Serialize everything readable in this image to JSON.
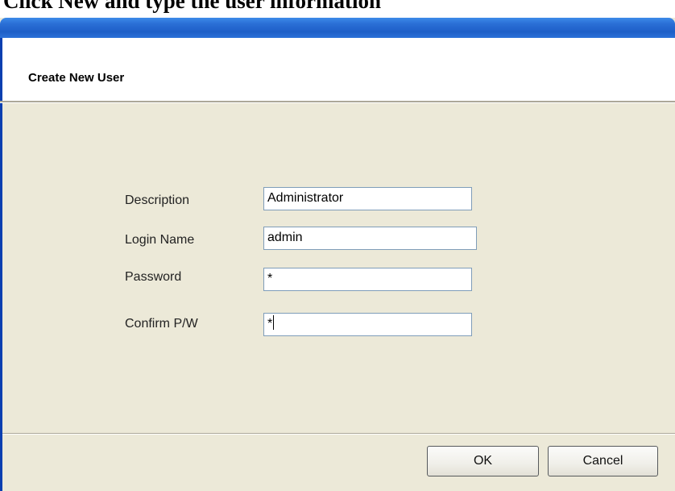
{
  "caption": "Click New and type the user information",
  "dialog": {
    "title": "Create New User"
  },
  "form": {
    "description_label": "Description",
    "description_value": "Administrator",
    "login_label": "Login Name",
    "login_value": "admin",
    "password_label": "Password",
    "password_value": "*",
    "confirm_label": "Confirm P/W",
    "confirm_value": "*"
  },
  "buttons": {
    "ok": "OK",
    "cancel": "Cancel"
  },
  "colors": {
    "dialog_background": "#ece9d8",
    "titlebar": "#2a6fd6",
    "input_border": "#7f9db9"
  }
}
